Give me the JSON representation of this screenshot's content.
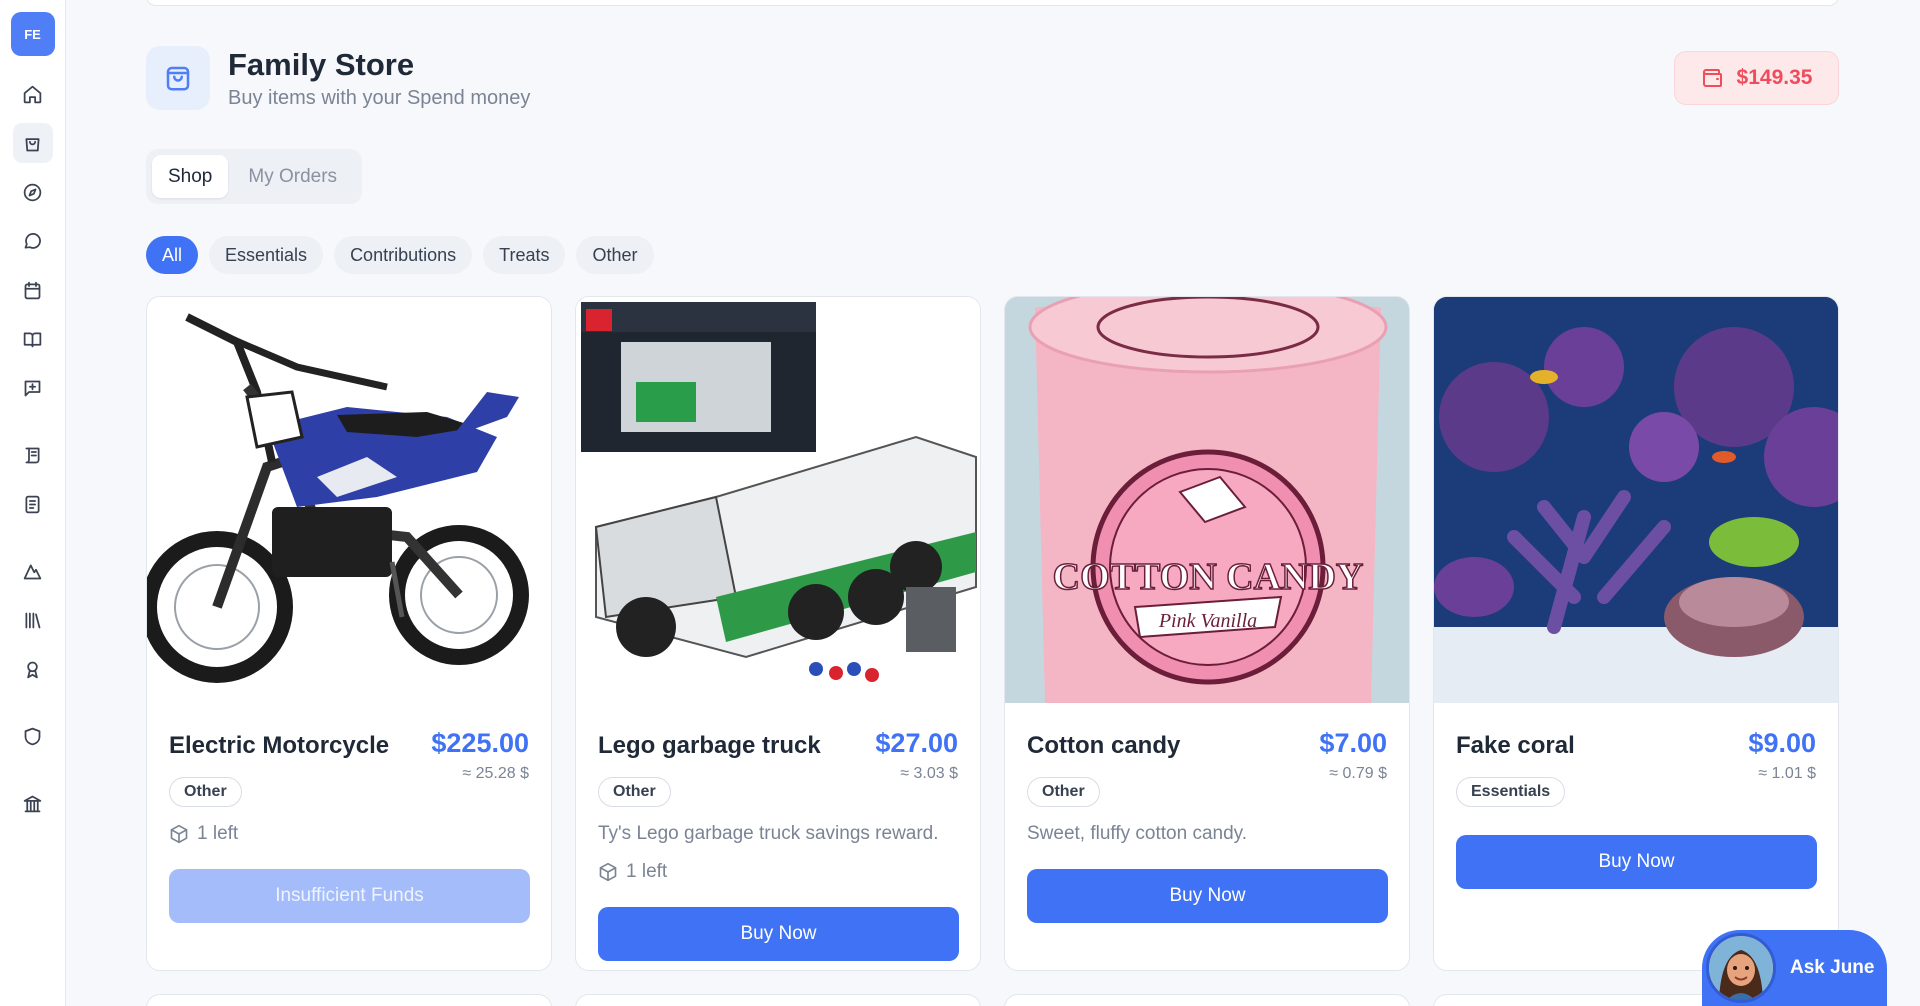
{
  "sidebar": {
    "avatar_initials": "FE",
    "items": [
      {
        "icon": "home-icon"
      },
      {
        "icon": "store-bag-icon",
        "active": true
      },
      {
        "icon": "compass-icon"
      },
      {
        "icon": "chat-icon"
      },
      {
        "icon": "calendar-icon"
      },
      {
        "icon": "book-open-icon"
      },
      {
        "icon": "message-plus-icon"
      },
      {
        "icon": "scroll-icon"
      },
      {
        "icon": "notebook-icon"
      },
      {
        "icon": "mountain-icon"
      },
      {
        "icon": "library-icon"
      },
      {
        "icon": "award-icon"
      },
      {
        "icon": "shield-icon"
      },
      {
        "icon": "bank-icon"
      }
    ]
  },
  "header": {
    "title": "Family Store",
    "subtitle": "Buy items with your Spend money",
    "icon": "shopping-bag-icon"
  },
  "balance": {
    "amount": "$149.35",
    "icon": "wallet-icon",
    "color": "#ef4c5c"
  },
  "tabs": [
    {
      "label": "Shop",
      "active": true
    },
    {
      "label": "My Orders",
      "active": false
    }
  ],
  "filters": [
    {
      "label": "All",
      "active": true
    },
    {
      "label": "Essentials"
    },
    {
      "label": "Contributions"
    },
    {
      "label": "Treats"
    },
    {
      "label": "Other"
    }
  ],
  "products": [
    {
      "title": "Electric Motorcycle",
      "price": "$225.00",
      "price_alt": "≈ 25.28 $",
      "category": "Other",
      "description": "",
      "stock": "1 left",
      "button": "Insufficient Funds",
      "button_disabled": true,
      "image": "electric-motorcycle-image"
    },
    {
      "title": "Lego garbage truck",
      "price": "$27.00",
      "price_alt": "≈ 3.03 $",
      "category": "Other",
      "description": "Ty's Lego garbage truck savings reward.",
      "stock": "1 left",
      "button": "Buy Now",
      "button_disabled": false,
      "image": "lego-garbage-truck-image"
    },
    {
      "title": "Cotton candy",
      "price": "$7.00",
      "price_alt": "≈ 0.79 $",
      "category": "Other",
      "description": "Sweet, fluffy cotton candy.",
      "stock": "",
      "button": "Buy Now",
      "button_disabled": false,
      "image": "cotton-candy-image",
      "image_text": "COTTON CANDY",
      "image_subtext": "Pink Vanilla"
    },
    {
      "title": "Fake coral",
      "price": "$9.00",
      "price_alt": "≈ 1.01 $",
      "category": "Essentials",
      "description": "",
      "stock": "",
      "button": "Buy Now",
      "button_disabled": false,
      "image": "fake-coral-image"
    }
  ],
  "assistant": {
    "label": "Ask June",
    "icon": "june-avatar"
  },
  "colors": {
    "accent": "#3f72f5",
    "disabled": "#a4bdfa",
    "background": "#f7f8fb"
  }
}
